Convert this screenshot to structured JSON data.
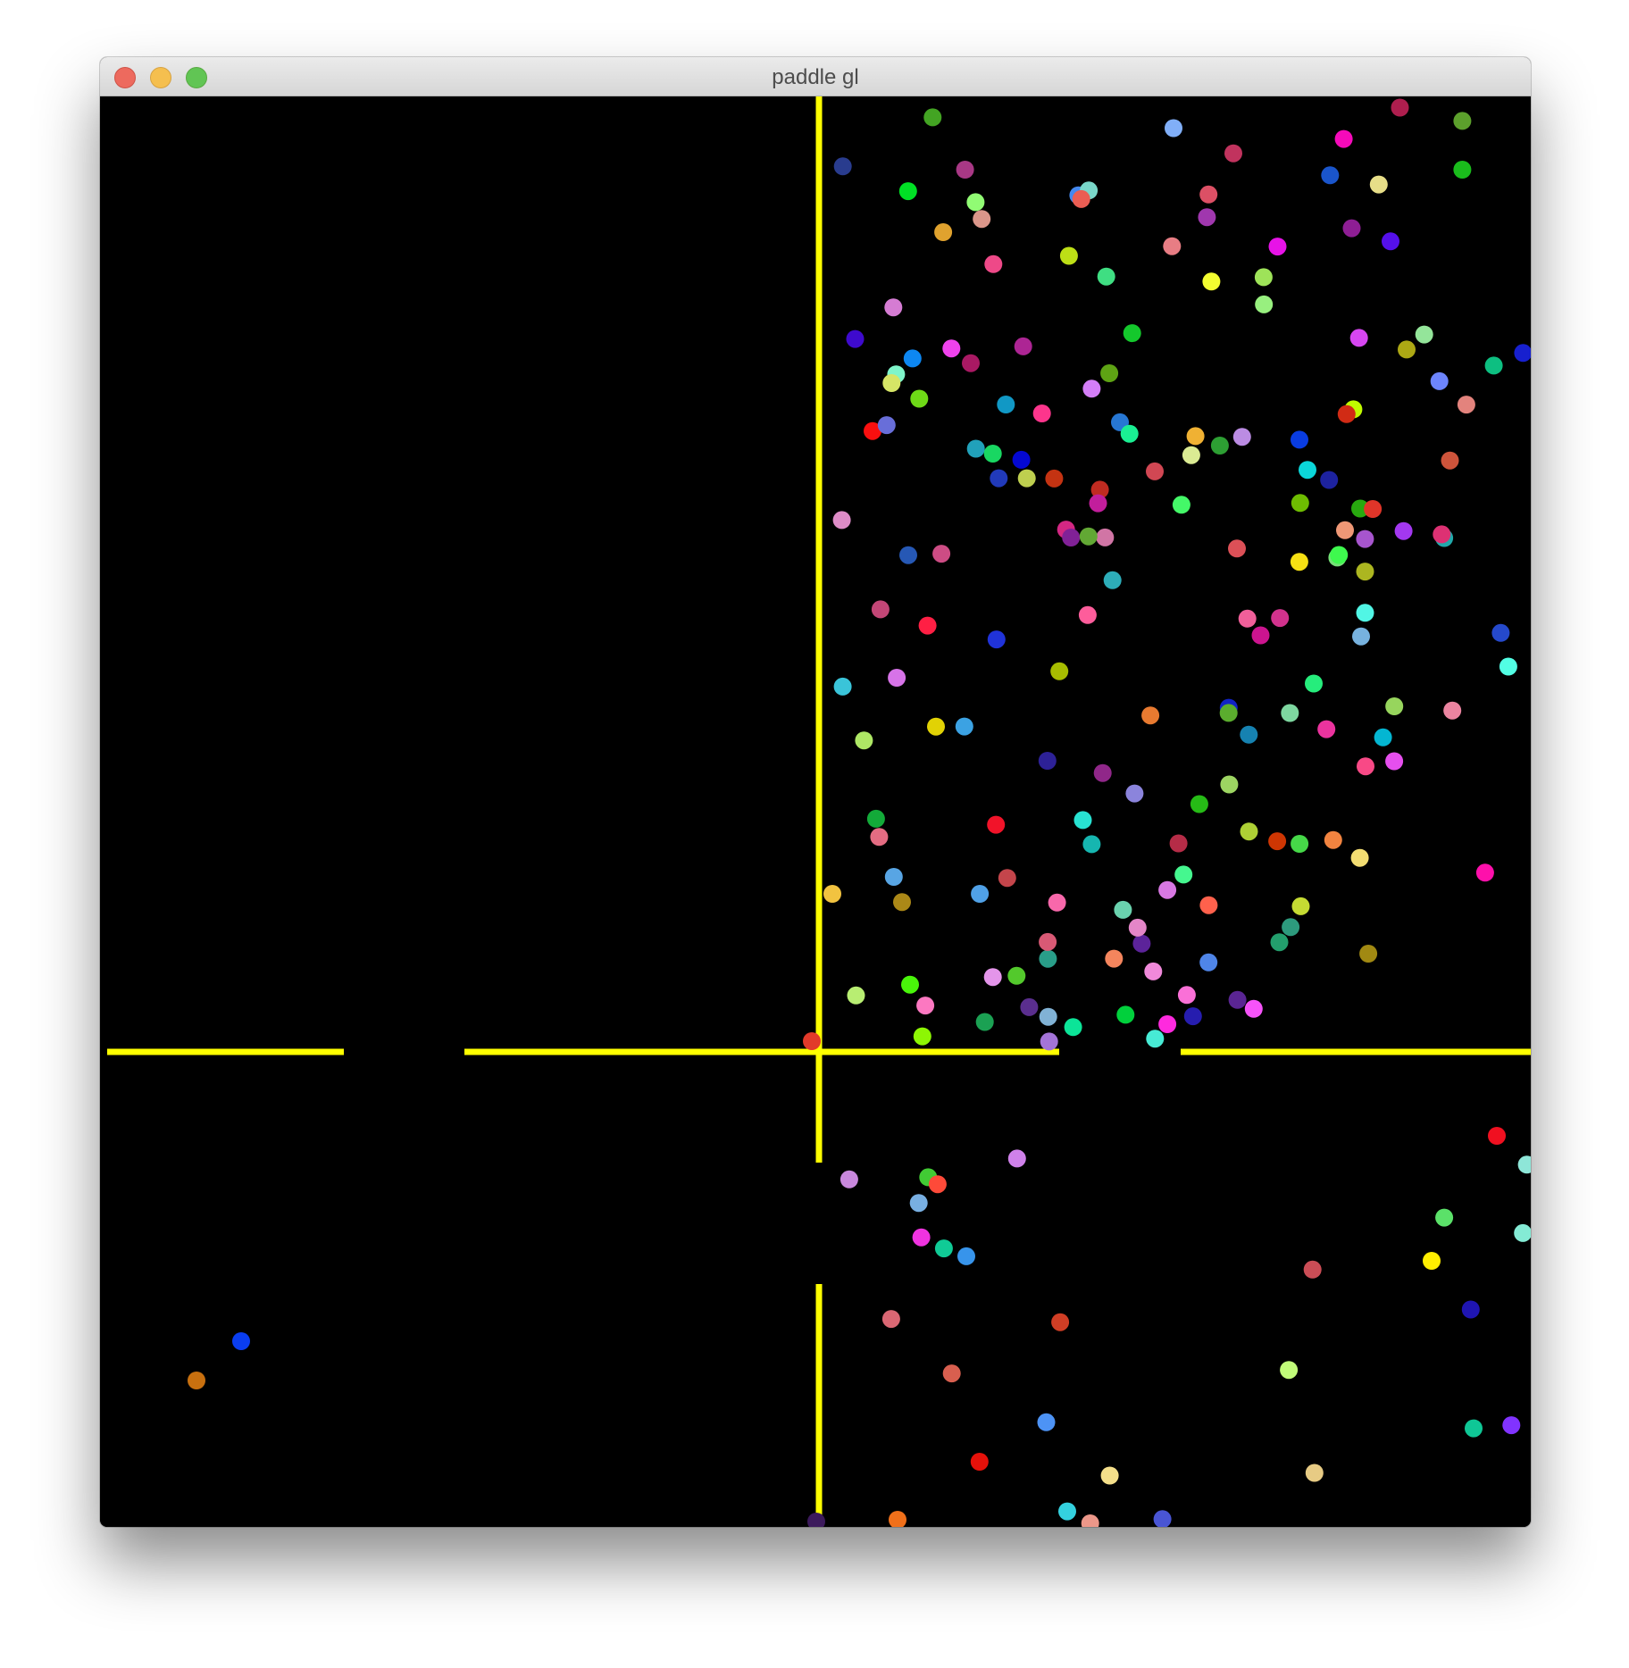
{
  "window": {
    "title": "paddle gl",
    "buttons": [
      "close",
      "minimize",
      "zoom"
    ]
  },
  "game": {
    "background": "#000000",
    "wall_color": "#ffff00",
    "ball_count": 214,
    "ball_shape": "circle"
  }
}
